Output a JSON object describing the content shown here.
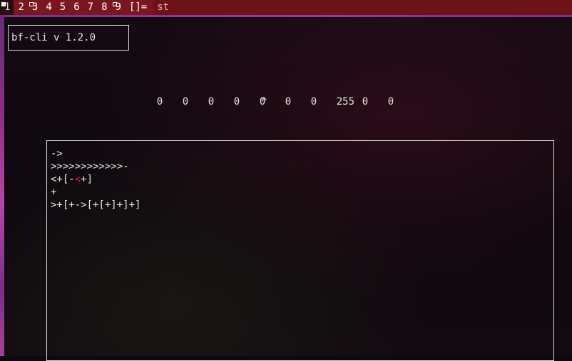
{
  "topbar": {
    "tags": [
      {
        "label": "1",
        "selected": true,
        "occupied": "filled"
      },
      {
        "label": "2",
        "selected": false,
        "occupied": "none"
      },
      {
        "label": "3",
        "selected": false,
        "occupied": "hollow"
      },
      {
        "label": "4",
        "selected": false,
        "occupied": "none"
      },
      {
        "label": "5",
        "selected": false,
        "occupied": "none"
      },
      {
        "label": "6",
        "selected": false,
        "occupied": "none"
      },
      {
        "label": "7",
        "selected": false,
        "occupied": "none"
      },
      {
        "label": "8",
        "selected": false,
        "occupied": "none"
      },
      {
        "label": "9",
        "selected": false,
        "occupied": "hollow"
      }
    ],
    "layout_symbol": "[]=",
    "window_title": "st",
    "colors": {
      "bar": "#7a1620",
      "selected_tag": "#2a0d12"
    }
  },
  "app": {
    "title": "bf-cli v 1.2.0"
  },
  "tape": {
    "cells": [
      "0",
      "0",
      "0",
      "0",
      "0",
      "0",
      "0",
      "255",
      "0",
      "0"
    ],
    "pointer_symbol": "^",
    "pointer_index": 5
  },
  "editor": {
    "lines": [
      {
        "before": "->",
        "cursor": "",
        "after": ""
      },
      {
        "before": ">>>>>>>>>>>>-",
        "cursor": "",
        "after": ""
      },
      {
        "before": "<+[-",
        "cursor": "<",
        "after": "+]"
      },
      {
        "before": "+",
        "cursor": "",
        "after": ""
      },
      {
        "before": ">+[+->[+[+]+]+]",
        "cursor": "",
        "after": ""
      }
    ],
    "cursor_color": "#e0202a"
  }
}
